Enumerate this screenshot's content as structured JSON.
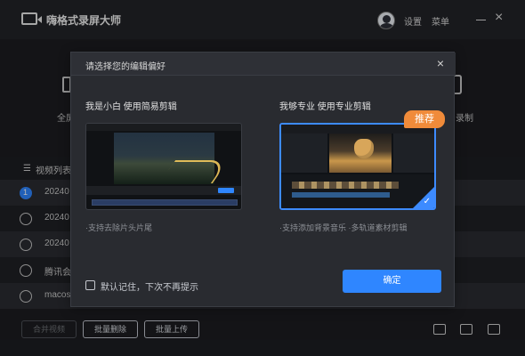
{
  "app": {
    "title": "嗨格式录屏大师",
    "settings": "设置",
    "menu": "菜单",
    "minimize_icon": "minimize-icon",
    "close_icon": "close-icon"
  },
  "background": {
    "left_tile_label": "全屏",
    "right_tile_label": "录制",
    "list_title": "视频列表",
    "rows": [
      {
        "text": "20240",
        "selected_number": "1"
      },
      {
        "text": "20240"
      },
      {
        "text": "20240"
      },
      {
        "text": "腾讯会"
      },
      {
        "text": "macos"
      }
    ],
    "buttons": {
      "merge": "合并视频",
      "batch_delete": "批量删除",
      "batch_upload": "批量上传"
    }
  },
  "dialog": {
    "title": "请选择您的编辑偏好",
    "close": "×",
    "option_left": {
      "title": "我是小白 使用简易剪辑",
      "caption": "·支持去除片头片尾"
    },
    "option_right": {
      "title": "我够专业 使用专业剪辑",
      "badge": "推荐",
      "caption": "·支持添加背景音乐 ·多轨道素材剪辑",
      "selected": true
    },
    "remember": "默认记住，下次不再提示",
    "confirm": "确定"
  },
  "colors": {
    "accent": "#2f86ff",
    "badge": "#f08b3a",
    "dialog_bg": "#292b30",
    "app_bg": "#1b1c20"
  }
}
